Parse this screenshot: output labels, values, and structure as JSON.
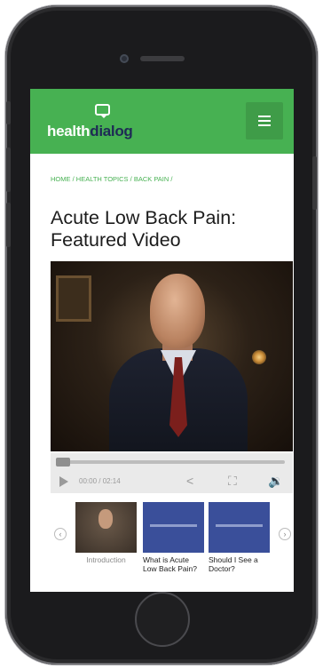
{
  "brand": {
    "logo_part1": "health",
    "logo_part2": "dialog",
    "green": "#47b152",
    "navy": "#1e2a55"
  },
  "header": {
    "menu_icon": "hamburger-menu-icon"
  },
  "breadcrumb": [
    "HOME",
    "HEALTH TOPICS",
    "BACK PAIN"
  ],
  "breadcrumb_sep": "/",
  "page": {
    "title": "Acute Low Back Pain: Featured Video"
  },
  "player": {
    "time_display": "00:00 / 02:14",
    "progress_fraction": 0,
    "icons": [
      "play-icon",
      "share-icon",
      "fullscreen-icon",
      "volume-icon"
    ]
  },
  "related_videos": [
    {
      "label": "Introduction"
    },
    {
      "label": "What is Acute Low Back Pain?"
    },
    {
      "label": "Should I See a Doctor?"
    }
  ]
}
